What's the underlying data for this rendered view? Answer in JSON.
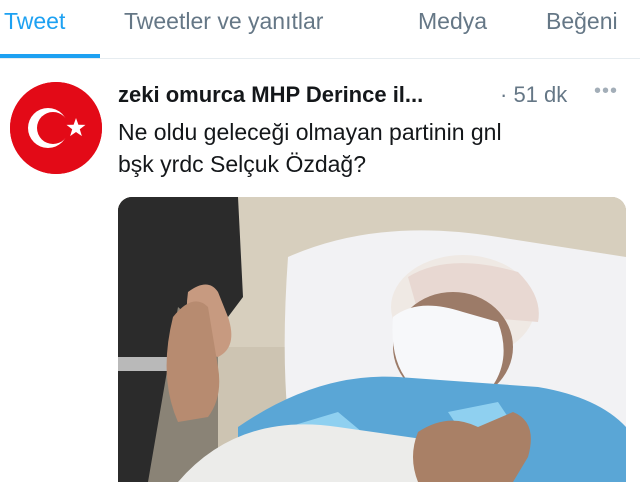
{
  "tabs": [
    {
      "label": "Tweet",
      "active": true
    },
    {
      "label": "Tweetler ve yanıtlar",
      "active": false
    },
    {
      "label": "Medya",
      "active": false
    },
    {
      "label": "Beğeni",
      "active": false
    }
  ],
  "tweet": {
    "author": "zeki omurca MHP Derince il...",
    "time": "· 51 dk",
    "text_line1": "Ne oldu geleceği olmayan partinin gnl",
    "text_line2": "bşk yrdc Selçuk Özdağ?",
    "avatar_icon": "turkish-flag-icon",
    "more_icon": "more-options-icon"
  },
  "colors": {
    "accent": "#1da1f2",
    "muted": "#657786",
    "text": "#14171a",
    "flag_red": "#e30a17"
  }
}
